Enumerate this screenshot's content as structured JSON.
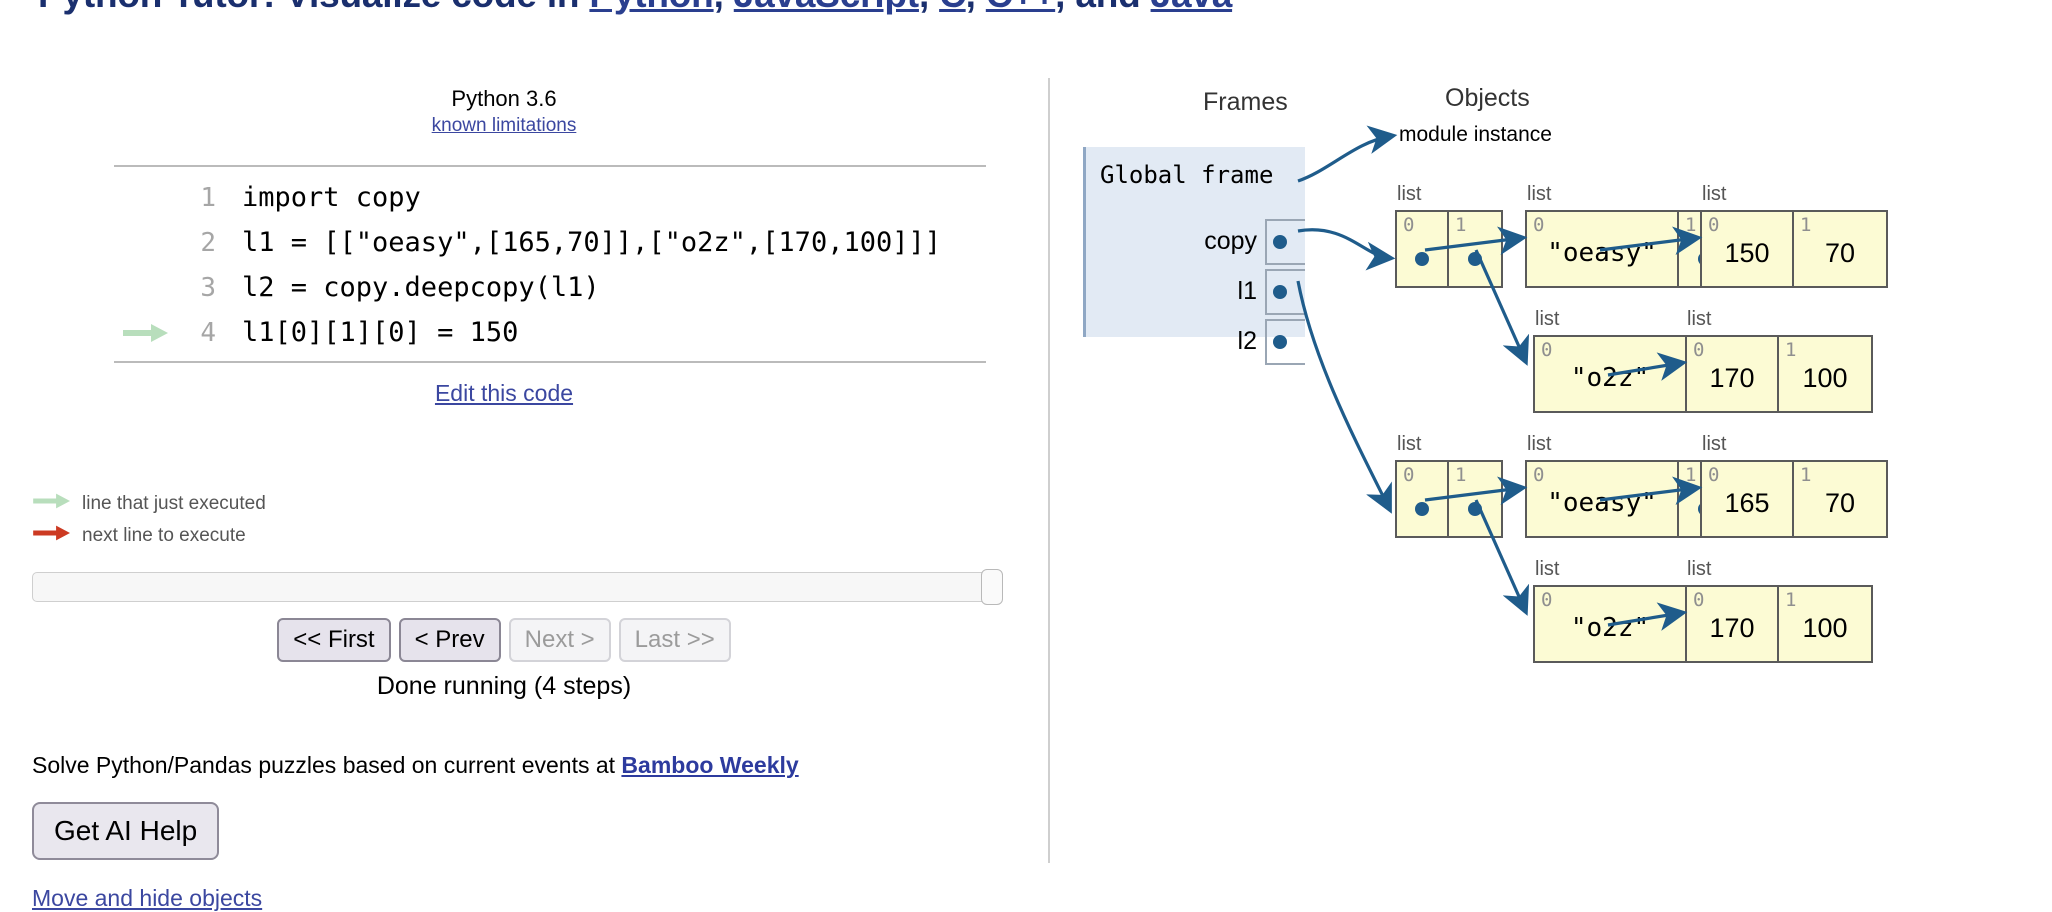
{
  "site": {
    "title_prefix": "Python Tutor: Visualize code in ",
    "lang_python": "Python",
    "sep1": ", ",
    "lang_javascript": "JavaScript",
    "sep2": ", ",
    "lang_c": "C",
    "sep3": ", ",
    "lang_cpp": "C++",
    "sep4": ", and ",
    "lang_java": "Java"
  },
  "editor": {
    "version_label": "Python 3.6",
    "known_limitations_label": "known limitations",
    "edit_code_label": "Edit this code",
    "lines": [
      {
        "num": "1",
        "text": "import copy",
        "arrow": "none"
      },
      {
        "num": "2",
        "text": "l1 = [[\"oeasy\",[165,70]],[\"o2z\",[170,100]]]",
        "arrow": "none"
      },
      {
        "num": "3",
        "text": "l2 = copy.deepcopy(l1)",
        "arrow": "none"
      },
      {
        "num": "4",
        "text": "l1[0][1][0] = 150",
        "arrow": "green"
      }
    ]
  },
  "legend": {
    "just_executed": "line that just executed",
    "next_line": "next line to execute",
    "green_color": "#b8debc",
    "red_color": "#cc3a22"
  },
  "controls": {
    "first_label": "<< First",
    "prev_label": "< Prev",
    "next_label": "Next >",
    "last_label": "Last >>",
    "status": "Done running (4 steps)"
  },
  "promo": {
    "text_before": "Solve Python/Pandas puzzles based on current events at ",
    "link_label": "Bamboo Weekly",
    "ai_help_label": "Get AI Help",
    "move_hide_label": "Move and hide objects"
  },
  "viz": {
    "frames_header": "Frames",
    "objects_header": "Objects",
    "frame_title": "Global frame",
    "variables": [
      {
        "name": "copy"
      },
      {
        "name": "l1"
      },
      {
        "name": "l2"
      }
    ],
    "module_instance_label": "module instance",
    "list_type_label": "list",
    "objects": [
      {
        "id": "l1_outer",
        "label": "list",
        "cells": [
          {
            "idx": "0",
            "value": "",
            "pointer": true
          },
          {
            "idx": "1",
            "value": "",
            "pointer": true
          }
        ]
      },
      {
        "id": "l1_pair0",
        "label": "list",
        "cells": [
          {
            "idx": "0",
            "value": "\"oeasy\"",
            "pointer": false
          },
          {
            "idx": "1",
            "value": "",
            "pointer": true
          }
        ]
      },
      {
        "id": "l1_nums0",
        "label": "list",
        "cells": [
          {
            "idx": "0",
            "value": "150",
            "pointer": false
          },
          {
            "idx": "1",
            "value": "70",
            "pointer": false
          }
        ]
      },
      {
        "id": "l1_pair1",
        "label": "list",
        "cells": [
          {
            "idx": "0",
            "value": "\"o2z\"",
            "pointer": false
          },
          {
            "idx": "1",
            "value": "",
            "pointer": true
          }
        ]
      },
      {
        "id": "l1_nums1",
        "label": "list",
        "cells": [
          {
            "idx": "0",
            "value": "170",
            "pointer": false
          },
          {
            "idx": "1",
            "value": "100",
            "pointer": false
          }
        ]
      },
      {
        "id": "l2_outer",
        "label": "list",
        "cells": [
          {
            "idx": "0",
            "value": "",
            "pointer": true
          },
          {
            "idx": "1",
            "value": "",
            "pointer": true
          }
        ]
      },
      {
        "id": "l2_pair0",
        "label": "list",
        "cells": [
          {
            "idx": "0",
            "value": "\"oeasy\"",
            "pointer": false
          },
          {
            "idx": "1",
            "value": "",
            "pointer": true
          }
        ]
      },
      {
        "id": "l2_nums0",
        "label": "list",
        "cells": [
          {
            "idx": "0",
            "value": "165",
            "pointer": false
          },
          {
            "idx": "1",
            "value": "70",
            "pointer": false
          }
        ]
      },
      {
        "id": "l2_pair1",
        "label": "list",
        "cells": [
          {
            "idx": "0",
            "value": "\"o2z\"",
            "pointer": false
          },
          {
            "idx": "1",
            "value": "",
            "pointer": true
          }
        ]
      },
      {
        "id": "l2_nums1",
        "label": "list",
        "cells": [
          {
            "idx": "0",
            "value": "170",
            "pointer": false
          },
          {
            "idx": "1",
            "value": "100",
            "pointer": false
          }
        ]
      }
    ],
    "colors": {
      "frame_bg": "#e2eaf4",
      "object_bg": "#fcfbd4",
      "pointer": "#1f5c8b"
    }
  }
}
